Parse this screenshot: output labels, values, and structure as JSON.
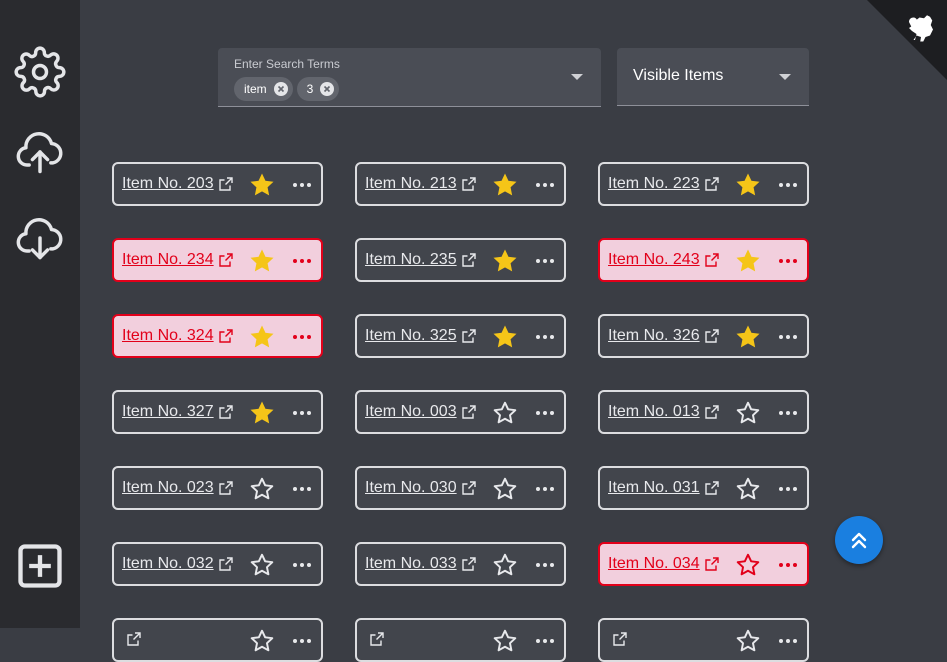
{
  "search": {
    "label": "Enter Search Terms",
    "chips": [
      "item",
      "3"
    ]
  },
  "visible_select": {
    "value": "Visible Items"
  },
  "colors": {
    "star_filled": "#f5c518",
    "flag_border": "#e2001a",
    "flag_bg": "#f2cfdd",
    "fab": "#1a7fe0"
  },
  "icons": {
    "sidebar": [
      "gear-icon",
      "cloud-upload-icon",
      "cloud-download-icon",
      "add-box-icon"
    ],
    "corner": "dog-icon",
    "fab": "double-chevron-up-icon"
  },
  "items": [
    {
      "label": "Item No. 203",
      "starred": true,
      "flagged": false
    },
    {
      "label": "Item No. 213",
      "starred": true,
      "flagged": false
    },
    {
      "label": "Item No. 223",
      "starred": true,
      "flagged": false
    },
    {
      "label": "Item No. 234",
      "starred": true,
      "flagged": true
    },
    {
      "label": "Item No. 235",
      "starred": true,
      "flagged": false
    },
    {
      "label": "Item No. 243",
      "starred": true,
      "flagged": true
    },
    {
      "label": "Item No. 324",
      "starred": true,
      "flagged": true
    },
    {
      "label": "Item No. 325",
      "starred": true,
      "flagged": false
    },
    {
      "label": "Item No. 326",
      "starred": true,
      "flagged": false
    },
    {
      "label": "Item No. 327",
      "starred": true,
      "flagged": false
    },
    {
      "label": "Item No. 003",
      "starred": false,
      "flagged": false
    },
    {
      "label": "Item No. 013",
      "starred": false,
      "flagged": false
    },
    {
      "label": "Item No. 023",
      "starred": false,
      "flagged": false
    },
    {
      "label": "Item No. 030",
      "starred": false,
      "flagged": false
    },
    {
      "label": "Item No. 031",
      "starred": false,
      "flagged": false
    },
    {
      "label": "Item No. 032",
      "starred": false,
      "flagged": false
    },
    {
      "label": "Item No. 033",
      "starred": false,
      "flagged": false
    },
    {
      "label": "Item No. 034",
      "starred": false,
      "flagged": true
    },
    {
      "label": "",
      "starred": false,
      "flagged": false
    },
    {
      "label": "",
      "starred": false,
      "flagged": false
    },
    {
      "label": "",
      "starred": false,
      "flagged": false
    }
  ]
}
